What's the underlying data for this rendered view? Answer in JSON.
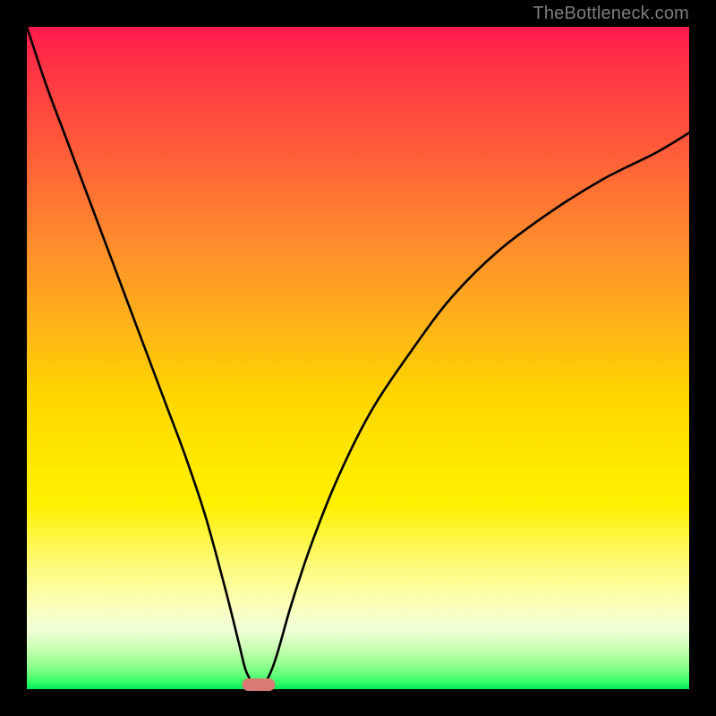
{
  "domain": "Chart",
  "watermark": "TheBottleneck.com",
  "colors": {
    "frame": "#000000",
    "curve_stroke": "#000000",
    "marker": "#d97a74",
    "gradient_top": "#ff1a4d",
    "gradient_bottom": "#00e65c"
  },
  "chart_data": {
    "type": "line",
    "title": "",
    "xlabel": "",
    "ylabel": "",
    "xlim": [
      0,
      100
    ],
    "ylim": [
      0,
      100
    ],
    "grid": false,
    "axes_visible": false,
    "legend": false,
    "marker": {
      "x": 35,
      "width_pct": 5
    },
    "series": [
      {
        "name": "bottleneck-curve",
        "x": [
          0,
          3,
          6,
          9,
          12,
          15,
          18,
          21,
          24,
          27,
          30,
          32,
          33,
          34,
          35,
          36,
          37,
          38,
          40,
          43,
          47,
          52,
          58,
          64,
          71,
          79,
          87,
          95,
          100
        ],
        "values": [
          100,
          91,
          83,
          75,
          67,
          59,
          51,
          43,
          35,
          26,
          15,
          7,
          3,
          1,
          0,
          1,
          3,
          6,
          13,
          22,
          32,
          42,
          51,
          59,
          66,
          72,
          77,
          81,
          84
        ]
      }
    ],
    "notes": "V-shaped black curve over rainbow vertical gradient; minimum at x≈35. Small rounded marker sits at the curve minimum on the x-axis."
  }
}
